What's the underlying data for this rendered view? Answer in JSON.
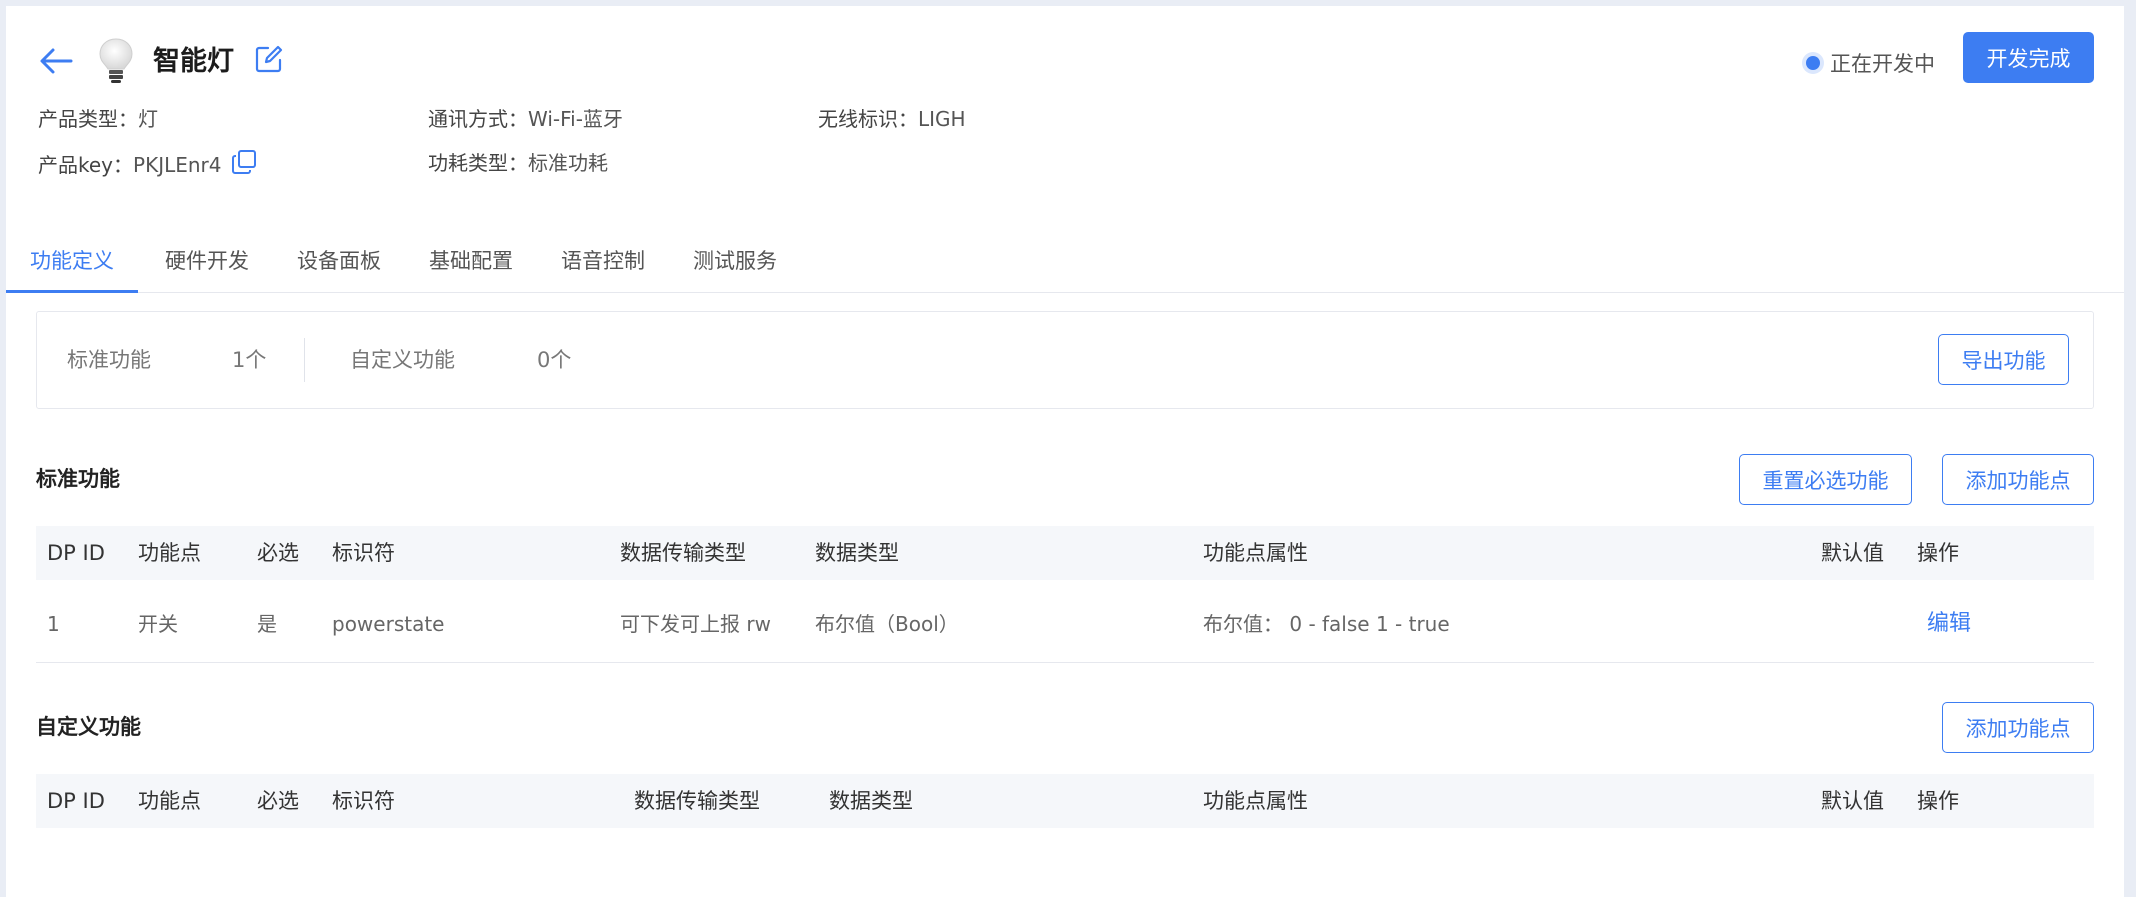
{
  "header": {
    "title": "智能灯",
    "status": "正在开发中",
    "complete_button": "开发完成"
  },
  "product_info": {
    "type_label": "产品类型：",
    "type_value": "灯",
    "comm_label": "通讯方式：",
    "comm_value": "Wi-Fi-蓝牙",
    "wireless_label": "无线标识：",
    "wireless_value": "LIGH",
    "key_label": "产品key：",
    "key_value": "PKJLEnr4",
    "power_label": "功耗类型：",
    "power_value": "标准功耗"
  },
  "tabs": [
    {
      "label": "功能定义",
      "active": true
    },
    {
      "label": "硬件开发",
      "active": false
    },
    {
      "label": "设备面板",
      "active": false
    },
    {
      "label": "基础配置",
      "active": false
    },
    {
      "label": "语音控制",
      "active": false
    },
    {
      "label": "测试服务",
      "active": false
    }
  ],
  "summary": {
    "standard_label": "标准功能",
    "standard_count": "1个",
    "custom_label": "自定义功能",
    "custom_count": "0个",
    "export_button": "导出功能"
  },
  "standard_section": {
    "title": "标准功能",
    "reset_button": "重置必选功能",
    "add_button": "添加功能点",
    "columns": [
      "DP ID",
      "功能点",
      "必选",
      "标识符",
      "数据传输类型",
      "数据类型",
      "功能点属性",
      "默认值",
      "操作"
    ],
    "rows": [
      {
        "dp_id": "1",
        "name": "开关",
        "required": "是",
        "identifier": "powerstate",
        "transfer": "可下发可上报 rw",
        "data_type": "布尔值（Bool）",
        "property": "布尔值： 0 - false 1 - true",
        "default": "",
        "action": "编辑"
      }
    ]
  },
  "custom_section": {
    "title": "自定义功能",
    "add_button": "添加功能点",
    "columns": [
      "DP ID",
      "功能点",
      "必选",
      "标识符",
      "数据传输类型",
      "数据类型",
      "功能点属性",
      "默认值",
      "操作"
    ]
  },
  "colors": {
    "accent": "#3d7df2",
    "background": "#e9edf5",
    "table_header": "#f5f7fa"
  }
}
